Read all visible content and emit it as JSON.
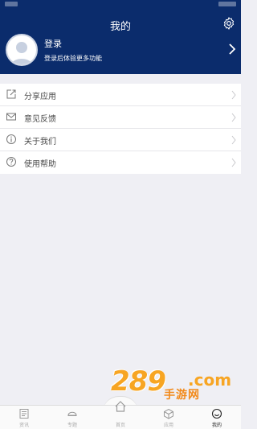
{
  "header": {
    "title": "我的",
    "settings_icon": "gear-icon",
    "bg_color": "#0b2c6c"
  },
  "profile": {
    "login_label": "登录",
    "subtitle": "登录后体验更多功能"
  },
  "menu": {
    "items": [
      {
        "label": "分享应用",
        "icon": "share-icon"
      },
      {
        "label": "意见反馈",
        "icon": "mail-icon"
      },
      {
        "label": "关于我们",
        "icon": "info-icon"
      },
      {
        "label": "使用帮助",
        "icon": "help-icon"
      }
    ]
  },
  "watermark": {
    "number": "289",
    "domain": ".com",
    "brand": "手游网"
  },
  "tabbar": {
    "tabs": [
      {
        "label": "资讯",
        "active": false
      },
      {
        "label": "专题",
        "active": false
      },
      {
        "label": "首页",
        "active": false
      },
      {
        "label": "应用",
        "active": false
      },
      {
        "label": "我的",
        "active": true
      }
    ]
  }
}
